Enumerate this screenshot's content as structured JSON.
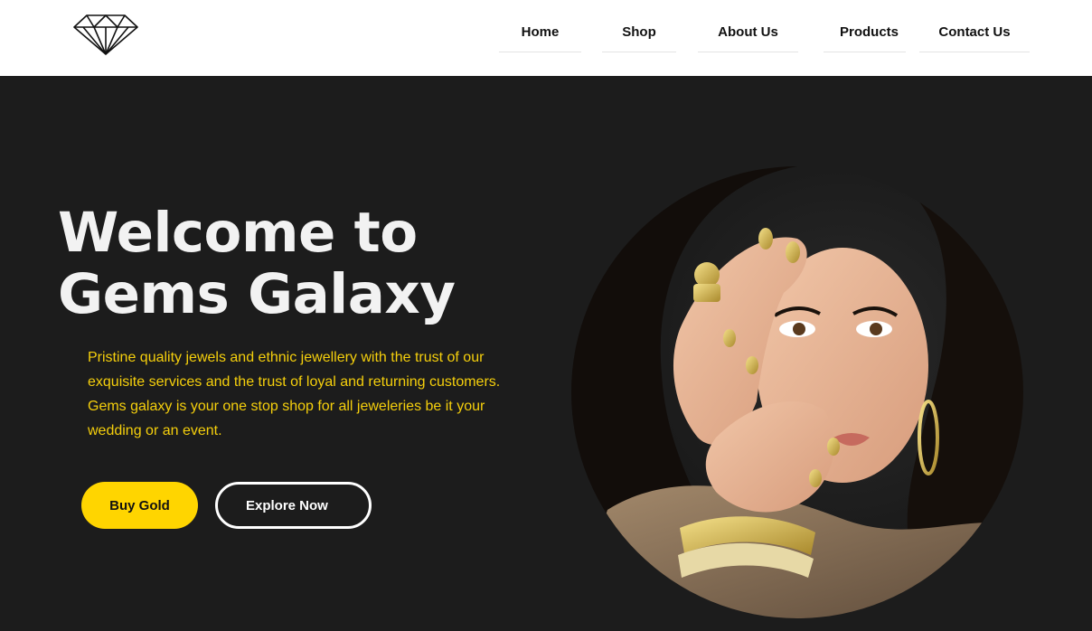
{
  "header": {
    "logo_icon": "diamond-icon",
    "nav": [
      {
        "label": "Home"
      },
      {
        "label": "Shop"
      },
      {
        "label": "About Us"
      },
      {
        "label": "Products"
      },
      {
        "label": "Contact Us"
      }
    ]
  },
  "hero": {
    "title_line1": "Welcome to",
    "title_line2": "Gems Galaxy",
    "description": "Pristine quality jewels and ethnic jewellery with the trust of our exquisite services and the trust of loyal and returning customers. Gems galaxy is your one stop shop for all jeweleries be it your wedding or an event.",
    "buy_button": "Buy Gold",
    "explore_button": "Explore Now"
  },
  "colors": {
    "accent": "#ffd500",
    "background": "#1c1c1c",
    "header": "#ffffff"
  }
}
